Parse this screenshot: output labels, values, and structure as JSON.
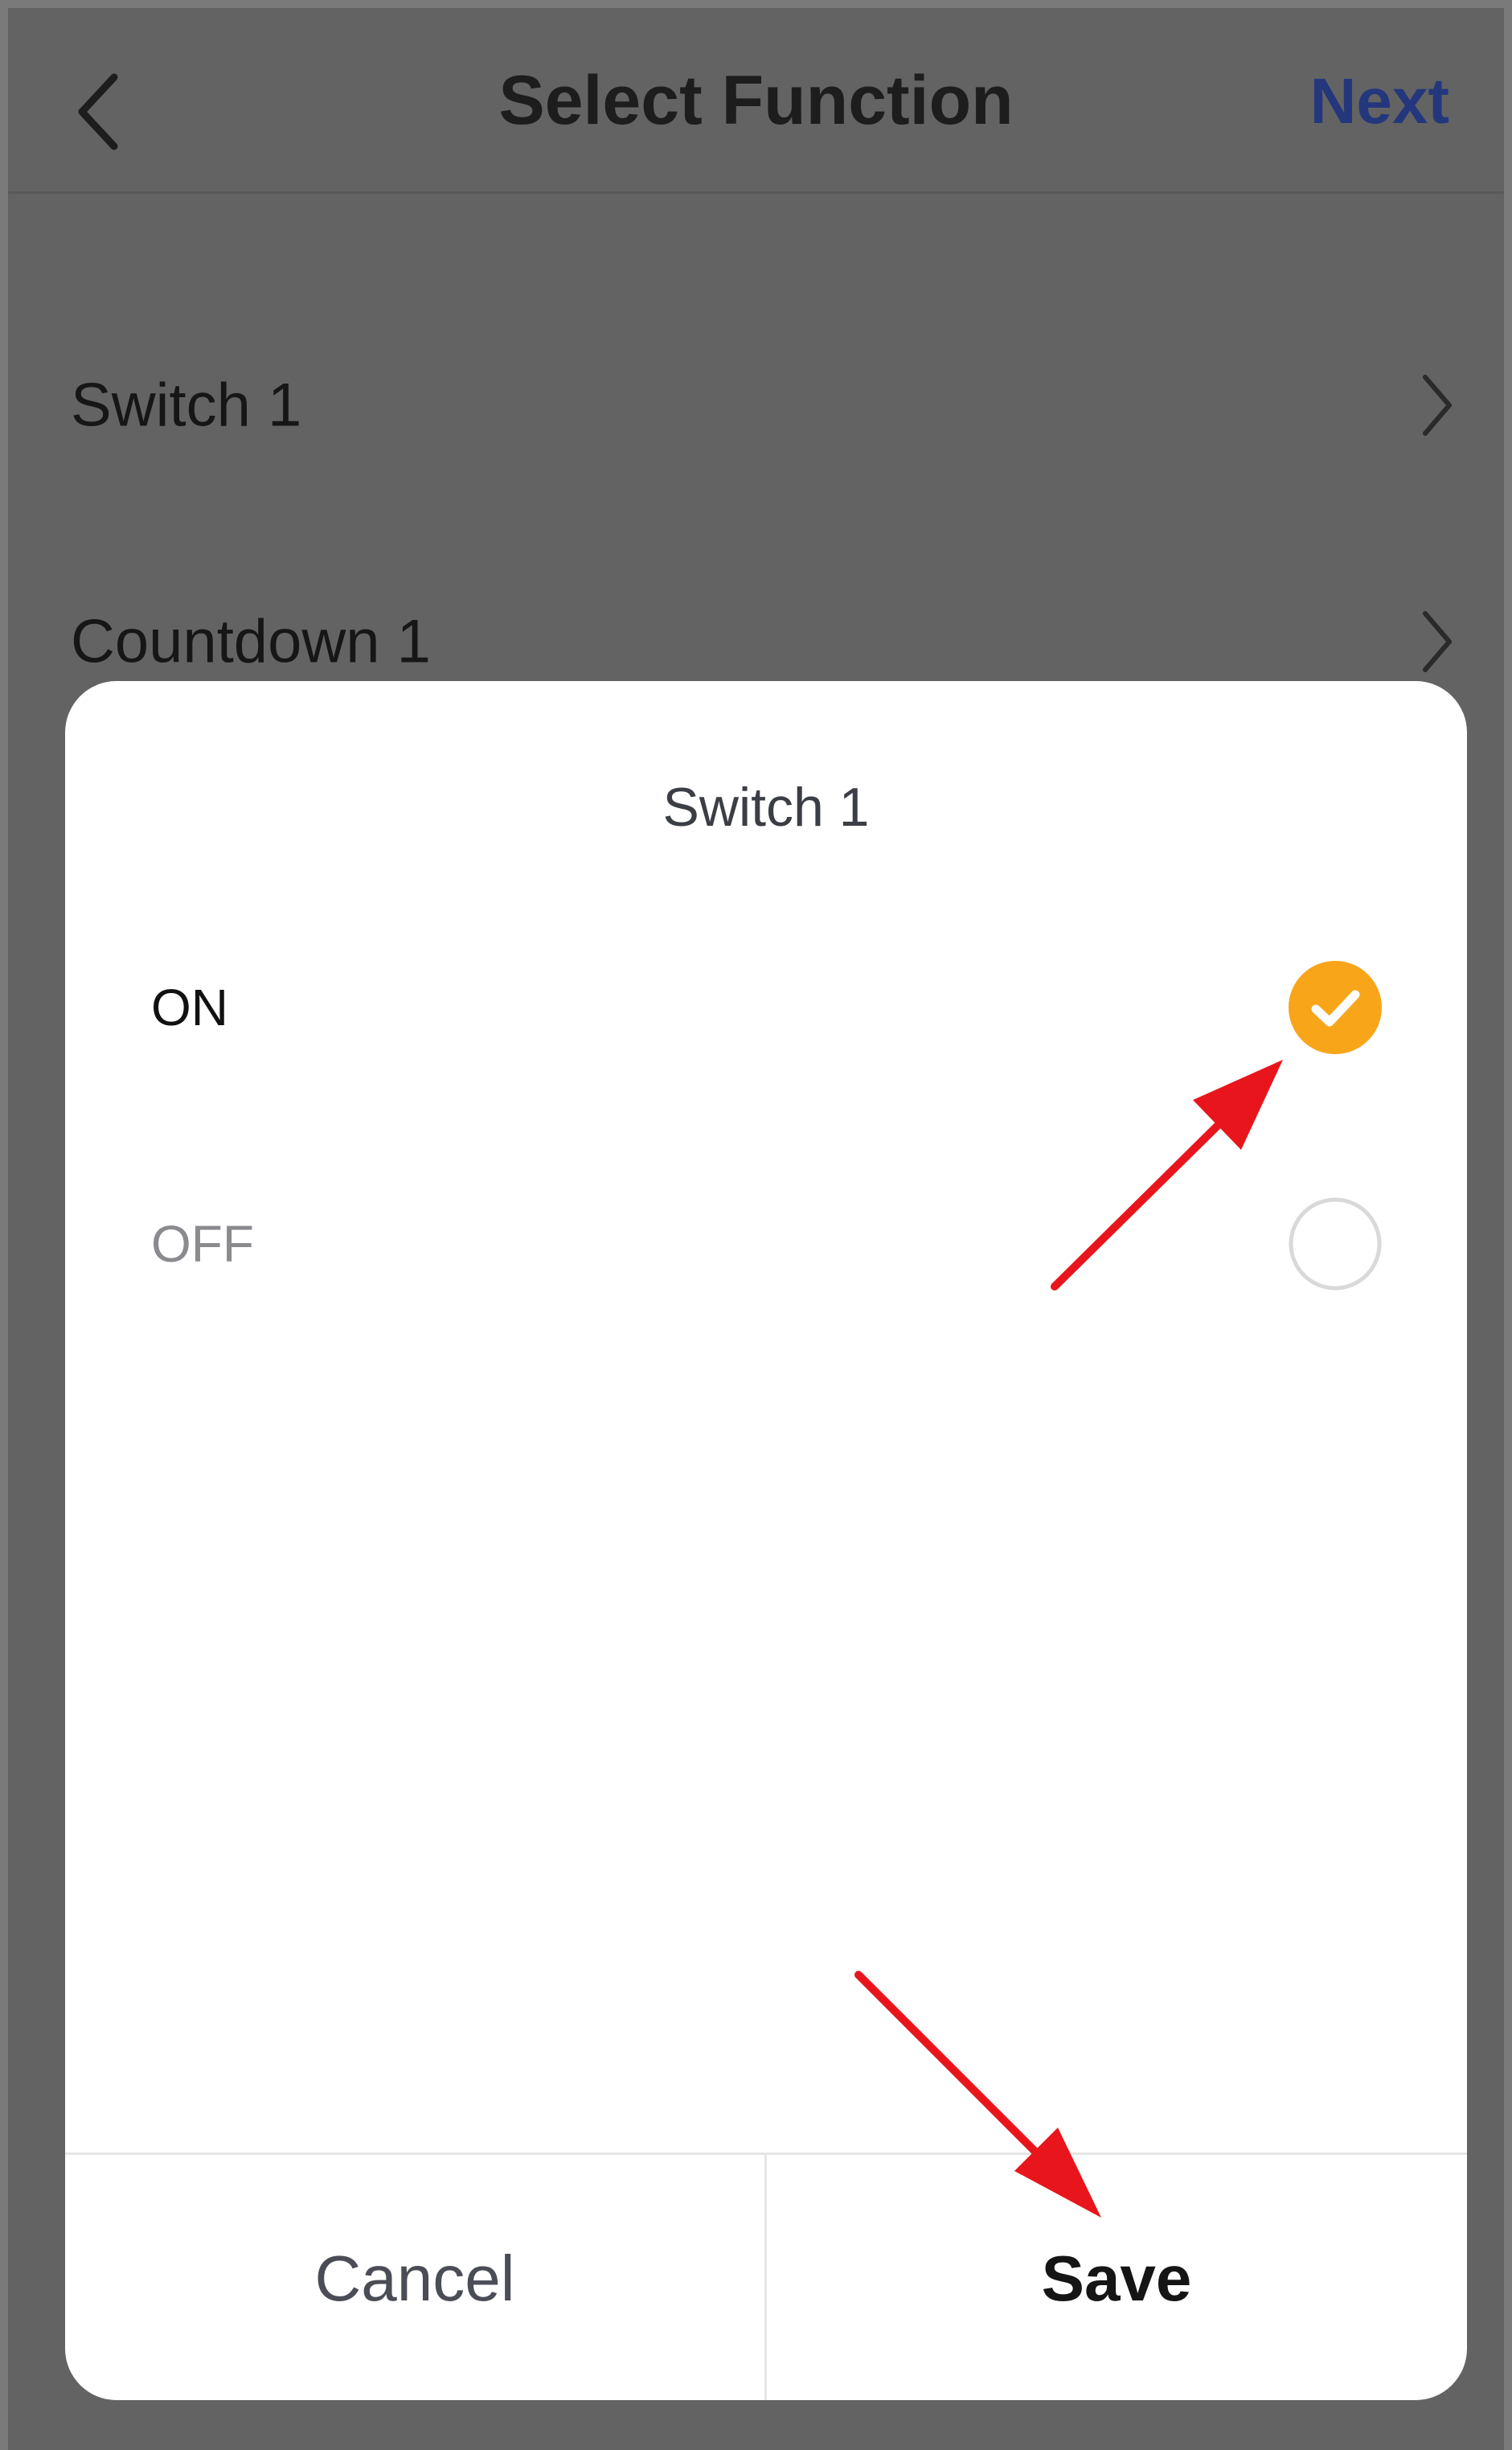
{
  "header": {
    "title": "Select Function",
    "next_label": "Next"
  },
  "rows": [
    {
      "label": "Switch 1"
    },
    {
      "label": "Countdown 1"
    }
  ],
  "dialog": {
    "title": "Switch 1",
    "options": [
      {
        "label": "ON",
        "selected": true
      },
      {
        "label": "OFF",
        "selected": false
      }
    ],
    "cancel_label": "Cancel",
    "save_label": "Save"
  },
  "icons": {
    "back": "chevron-left-icon",
    "row_arrow": "chevron-right-icon",
    "selected_radio": "checkmark-circle-icon",
    "unselected_radio": "empty-circle-icon",
    "annotation": "red-arrow"
  },
  "colors": {
    "accent_next": "#24377d",
    "selected_radio": "#f9a51a",
    "overlay": "#636363",
    "annotation_arrow": "#e8161c"
  }
}
